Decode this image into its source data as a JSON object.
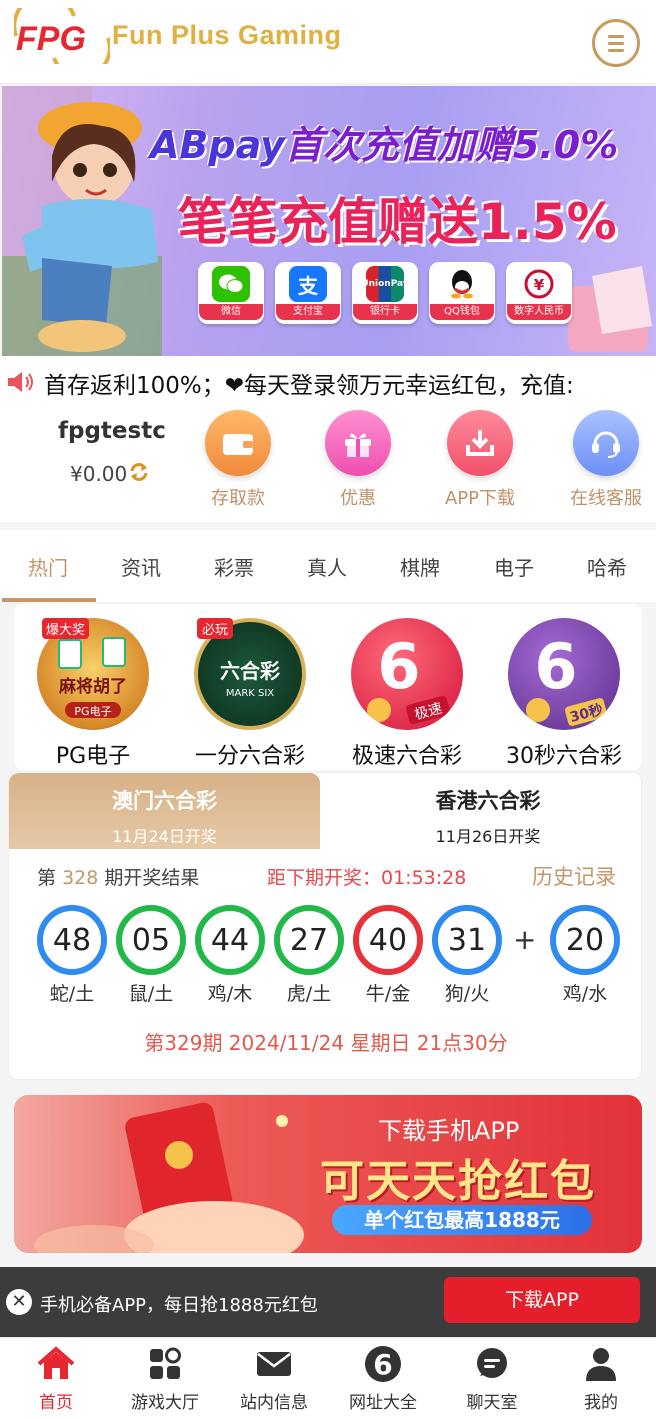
{
  "header": {
    "logo_text": "FPG",
    "brand": "Fun Plus Gaming",
    "menu_icon": "menu-icon"
  },
  "banner": {
    "line1_brand": "ABpay",
    "line1_rest": "首次充值加赠5.0%",
    "line2": "笔笔充值赠送1.5%",
    "payments": [
      {
        "label": "微信",
        "icon": "wechat-icon",
        "color": "#2dc100"
      },
      {
        "label": "支付宝",
        "icon": "alipay-icon",
        "color": "#1677ff"
      },
      {
        "label": "银行卡",
        "icon": "unionpay-icon",
        "color": "#d8232a"
      },
      {
        "label": "QQ钱包",
        "icon": "qq-icon",
        "color": "#111111"
      },
      {
        "label": "数字人民币",
        "icon": "ecny-icon",
        "color": "#c8102e"
      }
    ]
  },
  "notice": {
    "text": "首存返利100%；❤每天登录领万元幸运红包，充值:"
  },
  "user": {
    "name": "fpgtestc",
    "balance": "¥0.00"
  },
  "quick_actions": [
    {
      "label": "存取款",
      "icon": "wallet-icon"
    },
    {
      "label": "优惠",
      "icon": "gift-icon"
    },
    {
      "label": "APP下载",
      "icon": "download-icon"
    },
    {
      "label": "在线客服",
      "icon": "headset-icon"
    }
  ],
  "tabs": [
    "热门",
    "资讯",
    "彩票",
    "真人",
    "棋牌",
    "电子",
    "哈希"
  ],
  "games": [
    {
      "name": "PG电子",
      "badge": "爆大奖",
      "art": "麻将胡了",
      "sub": "PG电子"
    },
    {
      "name": "一分六合彩",
      "badge": "必玩",
      "art": "六合彩",
      "sub": "MARK SIX"
    },
    {
      "name": "极速六合彩",
      "badge": "",
      "art": "6",
      "sub": "极速"
    },
    {
      "name": "30秒六合彩",
      "badge": "",
      "art": "6",
      "sub": "30秒"
    }
  ],
  "lottery": {
    "tabs": [
      {
        "name": "澳门六合彩",
        "date": "11月24日开奖"
      },
      {
        "name": "香港六合彩",
        "date": "11月26日开奖"
      }
    ],
    "draw_prefix": "第",
    "draw_number": "328",
    "draw_suffix": "期开奖结果",
    "next_label": "距下期开奖：01:53:28",
    "history_label": "历史记录",
    "balls": [
      {
        "num": "48",
        "zodiac": "蛇/土",
        "color": "#2f8bf0"
      },
      {
        "num": "05",
        "zodiac": "鼠/土",
        "color": "#22b84a"
      },
      {
        "num": "44",
        "zodiac": "鸡/木",
        "color": "#22b84a"
      },
      {
        "num": "27",
        "zodiac": "虎/土",
        "color": "#22b84a"
      },
      {
        "num": "40",
        "zodiac": "牛/金",
        "color": "#e8323a"
      },
      {
        "num": "31",
        "zodiac": "狗/火",
        "color": "#2f8bf0"
      }
    ],
    "plus": "+",
    "special": {
      "num": "20",
      "zodiac": "鸡/水",
      "color": "#2f8bf0"
    },
    "next_issue": "第329期  2024/11/24  星期日  21点30分"
  },
  "app_banner": {
    "line1": "下载手机APP",
    "line2": "可天天抢红包",
    "line3": "单个红包最高1888元"
  },
  "download_bar": {
    "text": "手机必备APP，每日抢1888元红包",
    "button": "下载APP"
  },
  "bottom_nav": [
    {
      "label": "首页",
      "icon": "home-icon",
      "active": true
    },
    {
      "label": "游戏大厅",
      "icon": "games-grid-icon",
      "active": false
    },
    {
      "label": "站内信息",
      "icon": "mail-icon",
      "active": false
    },
    {
      "label": "网址大全",
      "icon": "six-icon",
      "active": false
    },
    {
      "label": "聊天室",
      "icon": "chat-icon",
      "active": false
    },
    {
      "label": "我的",
      "icon": "user-icon",
      "active": false
    }
  ]
}
